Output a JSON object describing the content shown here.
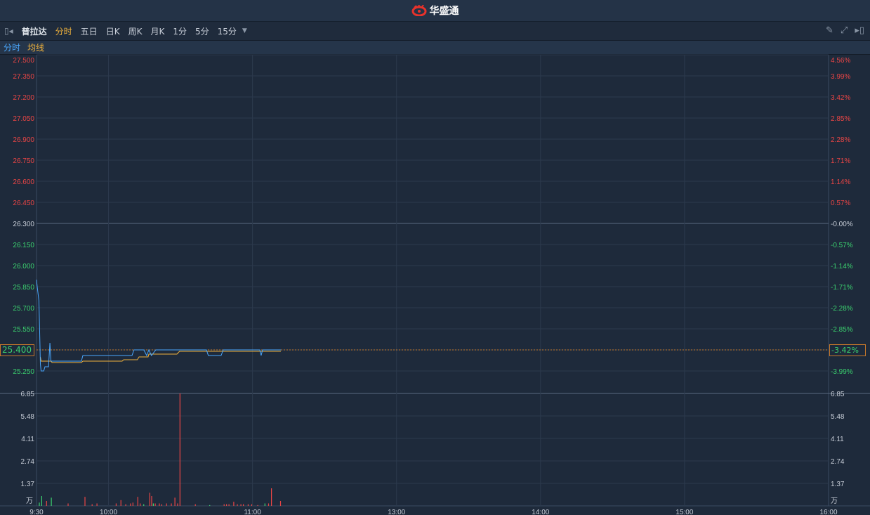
{
  "app": {
    "brand": "华盛通",
    "brand_color": "#e8322b"
  },
  "toolbar": {
    "stock_name": "普拉达",
    "tabs": [
      {
        "label": "分时",
        "active": true
      },
      {
        "label": "五日"
      },
      {
        "label": "日K"
      },
      {
        "label": "周K"
      },
      {
        "label": "月K"
      },
      {
        "label": "1分"
      },
      {
        "label": "5分"
      },
      {
        "label": "15分"
      }
    ]
  },
  "legend": {
    "price": "分时",
    "avg": "均线",
    "price_color": "#4aa8ff",
    "avg_color": "#f0b23c"
  },
  "price_axis": {
    "left": [
      "27.500",
      "27.350",
      "27.200",
      "27.050",
      "26.900",
      "26.750",
      "26.600",
      "26.450",
      "26.300",
      "26.150",
      "26.000",
      "25.850",
      "25.700",
      "25.550",
      "25.400",
      "25.250"
    ],
    "right": [
      "4.56%",
      "3.99%",
      "3.42%",
      "2.85%",
      "2.28%",
      "1.71%",
      "1.14%",
      "0.57%",
      "-0.00%",
      "-0.57%",
      "-1.14%",
      "-1.71%",
      "-2.28%",
      "-2.85%",
      "-3.42%",
      "-3.99%"
    ],
    "prev_close": 26.3,
    "max": 27.5,
    "step": 0.15
  },
  "current": {
    "price": "25.400",
    "change": "-3.42%"
  },
  "volume_axis": {
    "labels": [
      "6.85",
      "5.48",
      "4.11",
      "2.74",
      "1.37"
    ],
    "unit": "万",
    "max": 6.85
  },
  "time_axis": [
    "9:30",
    "10:00",
    "11:00",
    "13:00",
    "14:00",
    "15:00",
    "16:00"
  ],
  "chart_data": {
    "type": "line",
    "x_unit": "minutes since 9:30 (trading time)",
    "price": [
      [
        0,
        25.9
      ],
      [
        0.3,
        25.85
      ],
      [
        1,
        25.75
      ],
      [
        1.3,
        25.55
      ],
      [
        1.6,
        25.3
      ],
      [
        1.9,
        25.25
      ],
      [
        3,
        25.25
      ],
      [
        3.5,
        25.28
      ],
      [
        5,
        25.28
      ],
      [
        5.6,
        25.45
      ],
      [
        6,
        25.32
      ],
      [
        18.7,
        25.32
      ],
      [
        19.3,
        25.36
      ],
      [
        39.8,
        25.36
      ],
      [
        40.6,
        25.4
      ],
      [
        44.7,
        25.4
      ],
      [
        45.9,
        25.36
      ],
      [
        46.8,
        25.4
      ],
      [
        47.9,
        25.36
      ],
      [
        49.7,
        25.4
      ],
      [
        70.8,
        25.4
      ],
      [
        71.6,
        25.36
      ],
      [
        76.9,
        25.36
      ],
      [
        77.8,
        25.4
      ],
      [
        93,
        25.4
      ],
      [
        93.6,
        25.36
      ],
      [
        94.2,
        25.4
      ],
      [
        101.8,
        25.4
      ]
    ],
    "average": [
      [
        1.6,
        25.35
      ],
      [
        1.9,
        25.32
      ],
      [
        6,
        25.32
      ],
      [
        6.5,
        25.31
      ],
      [
        18.7,
        25.31
      ],
      [
        19.3,
        25.32
      ],
      [
        35.7,
        25.32
      ],
      [
        36.3,
        25.33
      ],
      [
        42,
        25.33
      ],
      [
        42.7,
        25.35
      ],
      [
        46.5,
        25.35
      ],
      [
        46.8,
        25.37
      ],
      [
        58.5,
        25.37
      ],
      [
        59.6,
        25.39
      ],
      [
        101.8,
        25.39
      ]
    ],
    "volume": [
      [
        1,
        0.2,
        "g"
      ],
      [
        2,
        0.6,
        "g"
      ],
      [
        4,
        0.3,
        "r"
      ],
      [
        6,
        0.5,
        "g"
      ],
      [
        13,
        0.15,
        "r"
      ],
      [
        20,
        0.55,
        "r"
      ],
      [
        23,
        0.1,
        "r"
      ],
      [
        25,
        0.15,
        "r"
      ],
      [
        33,
        0.15,
        "r"
      ],
      [
        35,
        0.35,
        "r"
      ],
      [
        37,
        0.1,
        "r"
      ],
      [
        39,
        0.15,
        "r"
      ],
      [
        40,
        0.2,
        "r"
      ],
      [
        42,
        0.55,
        "r"
      ],
      [
        43,
        0.15,
        "r"
      ],
      [
        44.5,
        0.1,
        "g"
      ],
      [
        47,
        0.8,
        "r"
      ],
      [
        47.8,
        0.6,
        "r"
      ],
      [
        48.5,
        0.15,
        "g"
      ],
      [
        49.3,
        0.15,
        "r"
      ],
      [
        51,
        0.15,
        "r"
      ],
      [
        52,
        0.1,
        "r"
      ],
      [
        54,
        0.15,
        "r"
      ],
      [
        56,
        0.15,
        "r"
      ],
      [
        57.5,
        0.5,
        "r"
      ],
      [
        58.6,
        0.15,
        "r"
      ],
      [
        59.6,
        6.85,
        "r"
      ],
      [
        66,
        0.1,
        "r"
      ],
      [
        72,
        0.05,
        "g"
      ],
      [
        78,
        0.1,
        "r"
      ],
      [
        79,
        0.1,
        "r"
      ],
      [
        80,
        0.1,
        "r"
      ],
      [
        82,
        0.25,
        "r"
      ],
      [
        83.5,
        0.1,
        "r"
      ],
      [
        85,
        0.1,
        "r"
      ],
      [
        86,
        0.1,
        "r"
      ],
      [
        88,
        0.1,
        "r"
      ],
      [
        89.5,
        0.1,
        "r"
      ],
      [
        92,
        0.05,
        "r"
      ],
      [
        95,
        0.15,
        "g"
      ],
      [
        96.5,
        0.15,
        "r"
      ],
      [
        97.7,
        1.07,
        "r"
      ],
      [
        101.5,
        0.3,
        "r"
      ]
    ]
  }
}
